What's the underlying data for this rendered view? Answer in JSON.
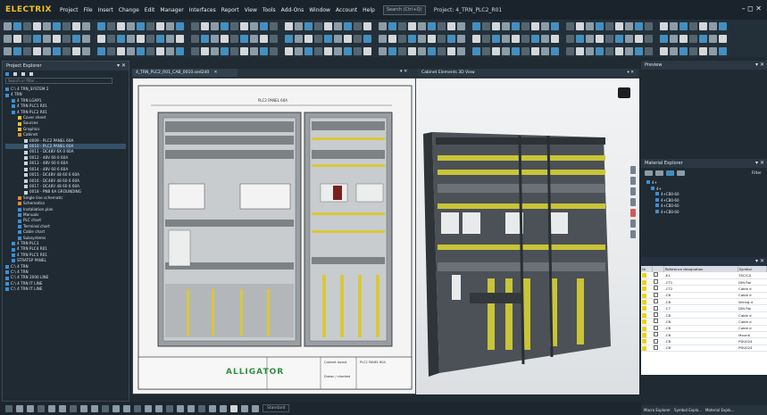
{
  "app": {
    "logo": "ELECTRIX",
    "menu": [
      "Project",
      "File",
      "Insert",
      "Change",
      "Edit",
      "Manager",
      "Interfaces",
      "Report",
      "View",
      "Tools",
      "Add-Ons",
      "Window",
      "Account",
      "Help"
    ],
    "search_placeholder": "Search (Ctrl+Q)",
    "project_label": "Project: 4_TRN_PLC2_R01",
    "window_controls": "–  ◻  ✕"
  },
  "left_panel": {
    "title": "Project Explorer",
    "filter_placeholder": "Search or filter...",
    "tree": [
      {
        "label": "C:\\ 4 TRN_SYSTEM 2",
        "icon": "folder",
        "indent": 0
      },
      {
        "label": "4 TRN",
        "icon": "folder",
        "indent": 0
      },
      {
        "label": "4 TRN LGAP1",
        "icon": "folder",
        "indent": 1
      },
      {
        "label": "4 TRN PLC1 R01",
        "icon": "folder",
        "indent": 1
      },
      {
        "label": "4 TRN PLC2 R01",
        "icon": "folder",
        "indent": 1
      },
      {
        "label": "Cover sheet",
        "icon": "sheet-y",
        "indent": 2
      },
      {
        "label": "Sources",
        "icon": "sheet-y",
        "indent": 2
      },
      {
        "label": "Graphics",
        "icon": "sheet-y",
        "indent": 2
      },
      {
        "label": "Cabinet",
        "icon": "sheet-o",
        "indent": 2
      },
      {
        "label": "0009 - PLC2 PANEL 60A",
        "icon": "page",
        "indent": 3
      },
      {
        "label": "0010 - PLC2 PANEL 60A",
        "icon": "page",
        "indent": 3,
        "selected": true
      },
      {
        "label": "0011 - DC48V 6X 0 60A",
        "icon": "page",
        "indent": 3
      },
      {
        "label": "0012 - 48V 60 6 60A",
        "icon": "page",
        "indent": 3
      },
      {
        "label": "0013 - 48V 60 6 60A",
        "icon": "page",
        "indent": 3
      },
      {
        "label": "0014 - 48V 60 6 60A",
        "icon": "page",
        "indent": 3
      },
      {
        "label": "0015 - DC48V 48 60 6 60A",
        "icon": "page",
        "indent": 3
      },
      {
        "label": "0016 - DC48V 48 60 6 60A",
        "icon": "page",
        "indent": 3
      },
      {
        "label": "0017 - DC48V 48 60 6 60A",
        "icon": "page",
        "indent": 3
      },
      {
        "label": "0018 - PNB 6A GROUNDING",
        "icon": "page",
        "indent": 3
      },
      {
        "label": "Single line schematic",
        "icon": "sheet-o",
        "indent": 2
      },
      {
        "label": "Schematics",
        "icon": "sheet-o",
        "indent": 2
      },
      {
        "label": "Installation plan",
        "icon": "sheet-b",
        "indent": 2
      },
      {
        "label": "Manuals",
        "icon": "folder",
        "indent": 2
      },
      {
        "label": "PLC chart",
        "icon": "sheet-b",
        "indent": 2
      },
      {
        "label": "Terminal chart",
        "icon": "sheet-b",
        "indent": 2
      },
      {
        "label": "Cable chart",
        "icon": "sheet-b",
        "indent": 2
      },
      {
        "label": "Subsystems",
        "icon": "sheet-b",
        "indent": 2
      },
      {
        "label": "4 TRN PLC3",
        "icon": "folder",
        "indent": 1
      },
      {
        "label": "4 TRN PLC4 R01",
        "icon": "folder",
        "indent": 1
      },
      {
        "label": "4 TRN PLC5 R01",
        "icon": "folder",
        "indent": 1
      },
      {
        "label": "STRATSP PANEL",
        "icon": "folder",
        "indent": 1
      },
      {
        "label": "C:\\ 4 TRN",
        "icon": "folder",
        "indent": 0
      },
      {
        "label": "C:\\ 4 TRN",
        "icon": "folder",
        "indent": 0
      },
      {
        "label": "C:\\ 4 TRN 2000 LINE",
        "icon": "folder",
        "indent": 0
      },
      {
        "label": "C:\\ 4 TRN IT LINE",
        "icon": "folder",
        "indent": 0
      },
      {
        "label": "C:\\ 4 TRN IT LINE",
        "icon": "folder",
        "indent": 0
      }
    ]
  },
  "tabs": [
    {
      "label": "4_TRN_PLC2_R01_CAB_0010.sed2d0",
      "close": "✕"
    },
    {
      "label": "Cabinet Elements 3D View",
      "close": ""
    }
  ],
  "drawing": {
    "title_block": {
      "company": "ALLIGATOR",
      "cell_1": "Cabinet layout",
      "cell_2": "PLC2 PANEL 60A",
      "cell_3": "Drawn / checked"
    },
    "top_dimension": "PLC2 PANEL 60A"
  },
  "right_panel": {
    "preview_title": "Preview",
    "material_title": "Material Explorer",
    "filter_label": "Filter",
    "material_tree": [
      "4+",
      "4+",
      "4+CB0-60",
      "4+CB0-60",
      "4+CB0-60",
      "4+CB0-60"
    ],
    "table_title": "",
    "columns": [
      "Nr",
      "",
      "Reference designation",
      "Symbol"
    ],
    "rows": [
      {
        "ref": "-K1",
        "sym": "3SC/CA"
      },
      {
        "ref": "-CT1",
        "sym": "DIN Rai"
      },
      {
        "ref": "-CT2",
        "sym": "Cable d"
      },
      {
        "ref": "-CB",
        "sym": "Cable d"
      },
      {
        "ref": "-CB",
        "sym": "Wiring d"
      },
      {
        "ref": "-C7",
        "sym": "DIN Rai"
      },
      {
        "ref": "-CB",
        "sym": "Cable d"
      },
      {
        "ref": "-CB",
        "sym": "Cable d"
      },
      {
        "ref": "-CB",
        "sym": "Cable d"
      },
      {
        "ref": "-CB",
        "sym": "Mounti"
      },
      {
        "ref": "-CB",
        "sym": "PDU024"
      },
      {
        "ref": "-CB",
        "sym": "PDU024"
      }
    ],
    "bottom_tabs": [
      "Macro Explorer",
      "Symbol Explo...",
      "Material Explo..."
    ]
  },
  "status": {
    "zoom": "Standard"
  }
}
